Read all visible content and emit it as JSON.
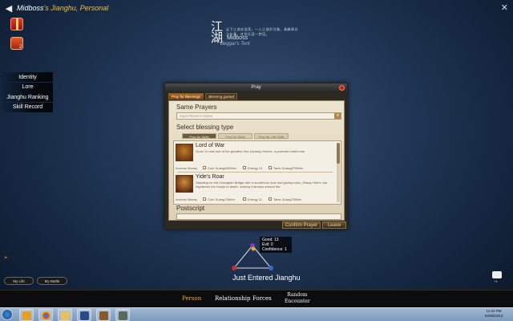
{
  "header": {
    "back_icon": "arrow-left-icon",
    "title_name": "Midboss",
    "title_rest": "'s Jianghu, Personal",
    "close_icon": "close-icon"
  },
  "side_icons": [
    "gift-icon",
    "scroll-icon"
  ],
  "side_badge": "2",
  "calligraphy": {
    "glyph": "江湖",
    "poem": "足下江湖本浩荡，一入江湖岁月摧。青峰翠谷当年事，仗剑天涯一梦回。"
  },
  "player": {
    "name": "Midboss",
    "tent": "Beggar's Tent"
  },
  "left_menu": [
    "Identity",
    "Lore",
    "Jianghu Ranking",
    "Skill Record"
  ],
  "dialog": {
    "title": "Pray",
    "tabs": [
      "Pray for Blessings",
      "Blessing gained"
    ],
    "same_prayers_label": "Same Prayers",
    "input_placeholder": "Input Pieces's Name",
    "select_type_label": "Select blessing type",
    "type_tabs": [
      "Pray for Skills",
      "Pray for Skills",
      "Pray for Life Skills"
    ],
    "blessings": [
      {
        "name": "Lord of War",
        "desc": "Guan Yu was one of the greatest Han Dynasty heroes, a powerful noble man",
        "cost_label": "Incense Money",
        "costs": [
          "Coin 3Liang450Wen",
          "Energy 13",
          "Taels 3Liang875Wen"
        ]
      },
      {
        "name": "Yide's Roar",
        "desc": "Standing on the Changban Bridge with a murderous look and glaring eyes, Zhang Yide's roar frightened  Xia Houjie to death, making it famous around the",
        "cost_label": "Incense Money",
        "costs": [
          "Coin 3Liang75Wen",
          "Energy 11",
          "Taels 3Liang75Wen"
        ]
      }
    ],
    "postscript_label": "Postscript",
    "confirm_label": "Confirm Prayer",
    "leave_label": "Leave"
  },
  "stats": {
    "good": "Good: 13",
    "evil": "Evil: 0",
    "confidence": "Confidence: 1"
  },
  "status_text": "Just Entered Jianghu",
  "bottom_buttons": {
    "my_life": "My Life",
    "my_battle": "My Battle"
  },
  "chat_count": "+1",
  "bottom_nav": {
    "person": "Person",
    "relationship": "Relationship",
    "forces": "Forces",
    "random_1": "Random",
    "random_2": "Encounter"
  },
  "taskbar": {
    "apps": [
      "windows-media-player",
      "chrome",
      "folder",
      "media",
      "game",
      "game2"
    ],
    "time": "11:22 PM",
    "date": "02/06/2013"
  },
  "colors": {
    "accent_gold": "#f0b020",
    "dialog_paper": "#ede4d0",
    "button_brown": "#6a5232"
  }
}
